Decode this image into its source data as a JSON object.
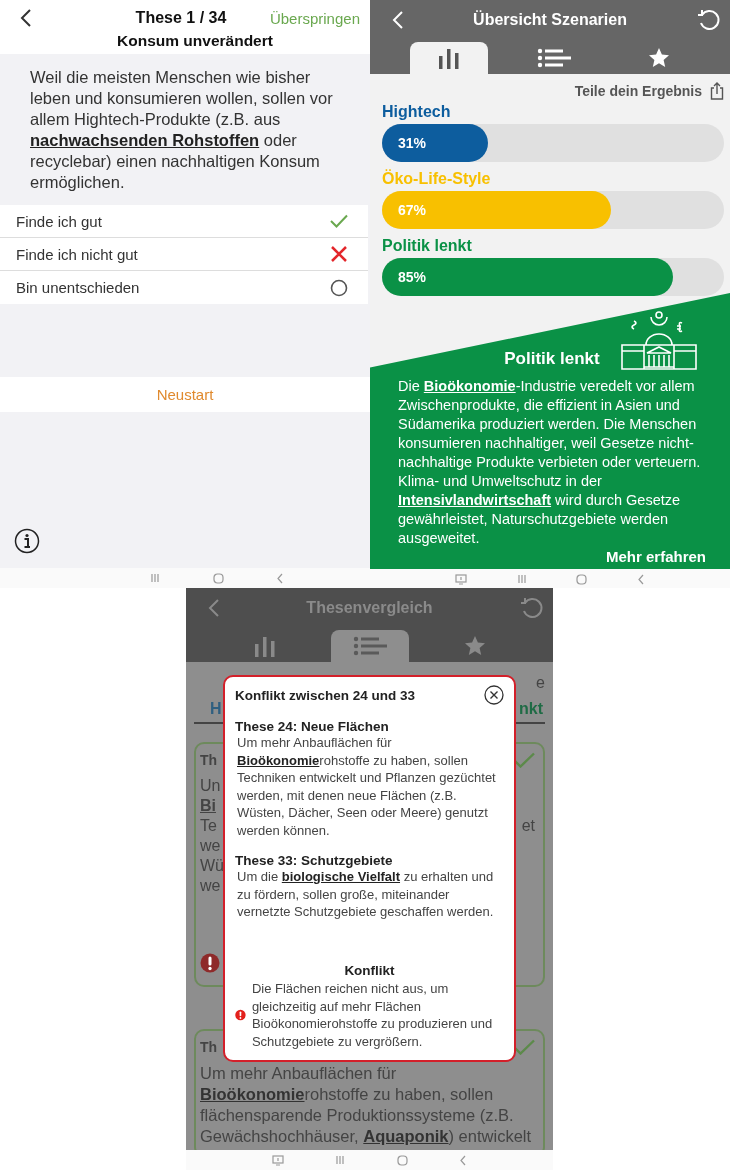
{
  "thesis_screen": {
    "counter": "These 1 / 34",
    "skip": "Überspringen",
    "title": "Konsum unverändert",
    "statement": "Weil die meisten Menschen wie bisher leben und konsumieren wollen, sollen vor allem  Hightech-Produkte (z.B. aus **nachwachsenden Rohstoffen** oder recyclebar) einen nachhaltigen Konsum ermöglichen.",
    "options": [
      {
        "label": "Finde ich gut",
        "kind": "agree"
      },
      {
        "label": "Finde ich nicht gut",
        "kind": "disagree"
      },
      {
        "label": "Bin unentschieden",
        "kind": "undecided"
      }
    ],
    "restart": "Neustart"
  },
  "results_screen": {
    "title": "Übersicht Szenarien",
    "tabs": [
      {
        "kind": "chart",
        "selected": true
      },
      {
        "kind": "list",
        "selected": false
      },
      {
        "kind": "star",
        "selected": false
      }
    ],
    "share": "Teile dein Ergebnis",
    "scenarios": [
      {
        "name": "Hightech",
        "reading": "31%",
        "level": 0.31,
        "color": "#0d5d9e"
      },
      {
        "name": "Öko-Life-Style",
        "reading": "67%",
        "level": 0.67,
        "color": "#f8c000"
      },
      {
        "name": "Politik lenkt",
        "reading": "85%",
        "level": 0.85,
        "color": "#0a9146"
      }
    ],
    "detail": {
      "title": "Politik lenkt",
      "text": "Die **Bioökonomie**-Industrie veredelt vor allem Zwischenprodukte, die effizient in Asien und Südamerika produziert werden. Die Menschen konsumieren nachhaltiger, weil Gesetze nicht-nachhaltige Produkte verbieten oder verteuern. Klima- und Umweltschutz in der **Intensivlandwirtschaft** wird durch Gesetze gewährleistet, Naturschutzgebiete werden ausgeweitet.",
      "more": "Mehr erfahren"
    }
  },
  "comparison_screen": {
    "title": "Thesenvergleich",
    "tabs": [
      {
        "kind": "chart",
        "selected": false
      },
      {
        "kind": "list",
        "selected": true
      },
      {
        "kind": "star",
        "selected": false
      }
    ],
    "share_fragment": "e",
    "scenario_tabs": [
      {
        "text": "H",
        "color": "#2f5f80"
      },
      {
        "text": "nkt",
        "color": "#1f6b45"
      }
    ],
    "cards": [
      {
        "title": "Th",
        "kind": "agree",
        "conflict": true,
        "lines": [
          {
            "text": "Un",
            "bold": false
          },
          {
            "text": "Bi",
            "bold": true
          },
          {
            "text": "Te",
            "bold": false,
            "right": "et"
          },
          {
            "text": "we",
            "bold": false
          },
          {
            "text": "Wü",
            "bold": false
          },
          {
            "text": "we",
            "bold": false
          }
        ]
      },
      {
        "title": "Th",
        "kind": "agree",
        "conflict": false,
        "text": "Um mehr Anbauflächen für **Bioökonomie**rohstoffe zu haben, sollen flächensparende Produktionssysteme (z.B. Gewächshochhäuser, **Aquaponik**) entwickelt"
      }
    ],
    "dialog": {
      "title": "Konflikt zwischen 24 und 33",
      "theses": [
        {
          "heading": "These 24: Neue Flächen",
          "text": "Um mehr Anbauflächen für **Bioökonomie**rohstoffe zu haben, sollen Techniken entwickelt und Pflanzen gezüchtet werden, mit denen neue Flächen (z.B. Wüsten, Dächer, Seen oder Meere) genutzt werden können."
        },
        {
          "heading": "These 33: Schutzgebiete",
          "text": "Um die **biologische Vielfalt** zu erhalten und zu fördern, sollen große, miteinander vernetzte Schutzgebiete geschaffen werden."
        }
      ],
      "conflict_heading": "Konflikt",
      "conflict_text": "Die Flächen reichen nicht aus, um gleichzeitig auf mehr Flächen Bioökonomierohstoffe zu produzieren und Schutzgebiete zu vergrößern."
    }
  }
}
